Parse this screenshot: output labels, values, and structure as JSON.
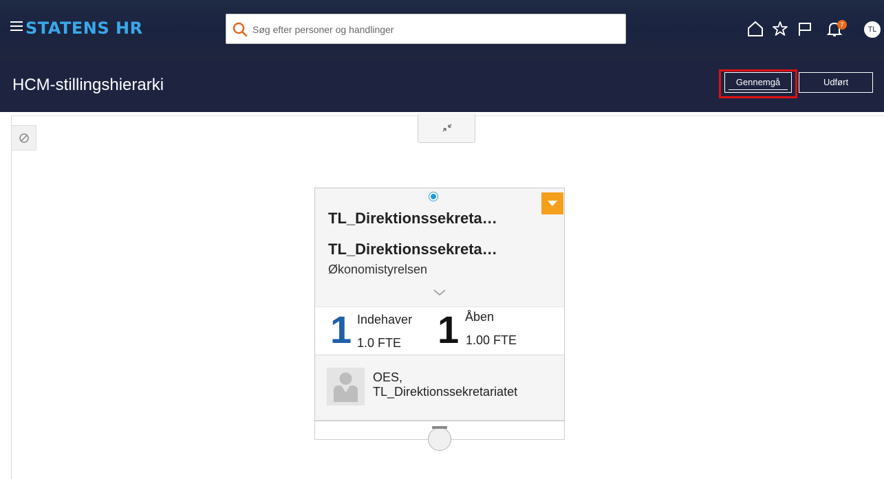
{
  "header": {
    "brand": "STATENS HR",
    "search_placeholder": "Søg efter personer og handlinger",
    "notification_count": "7",
    "user_initials": "TL"
  },
  "subheader": {
    "title": "HCM-stillingshierarki",
    "review_label": "Gennemgå",
    "done_label": "Udført"
  },
  "card": {
    "title": "TL_Direktionssekreta…",
    "subtitle": "TL_Direktionssekreta…",
    "organization": "Økonomistyrelsen",
    "incumbents": {
      "count": "1",
      "label": "Indehaver",
      "fte": "1.0 FTE"
    },
    "open": {
      "count": "1",
      "label": "Åben",
      "fte": "1.00 FTE"
    },
    "person_line1": "OES,",
    "person_line2": "TL_Direktionssekretariatet"
  },
  "colors": {
    "brand": "#3aa8e8",
    "header_bg": "#1e2440",
    "highlight": "#e01010",
    "dropdown": "#f4a01c",
    "incumbent_number": "#1f5fa8",
    "badge": "#e56a1b"
  }
}
